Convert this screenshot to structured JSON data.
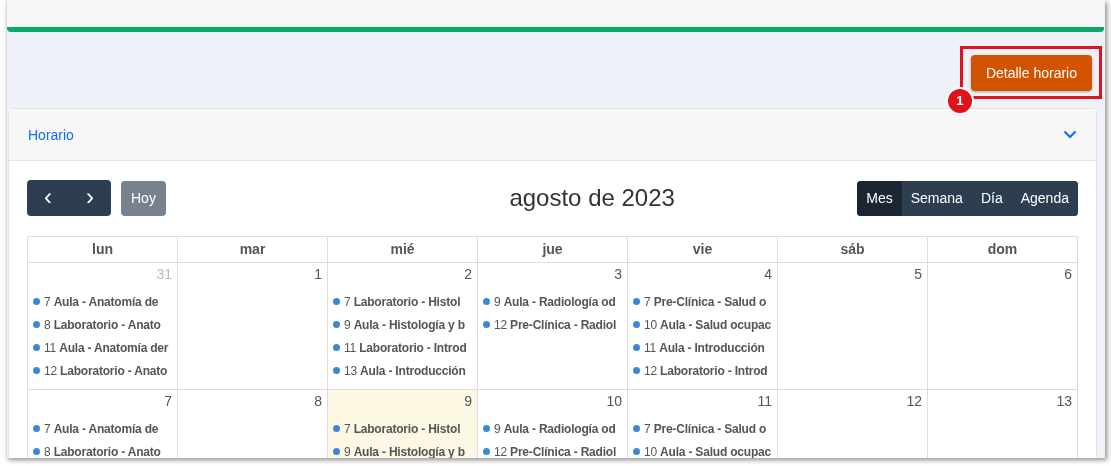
{
  "toolbar": {
    "button": "Detalle horario",
    "callout": "1"
  },
  "panel": {
    "title": "Horario",
    "expanded": true
  },
  "calendar": {
    "prev": "‹",
    "next": "›",
    "today_button": "Hoy",
    "title": "agosto de 2023",
    "views": [
      {
        "label": "Mes",
        "selected": true
      },
      {
        "label": "Semana",
        "selected": false
      },
      {
        "label": "Día",
        "selected": false
      },
      {
        "label": "Agenda",
        "selected": false
      }
    ],
    "weekdays": [
      "lun",
      "mar",
      "mié",
      "jue",
      "vie",
      "sáb",
      "dom"
    ],
    "weeks": [
      {
        "days": [
          {
            "date": "31",
            "off_month": true,
            "today": false,
            "events": [
              {
                "hour": "7",
                "title": "Aula - Anatomía de"
              },
              {
                "hour": "8",
                "title": "Laboratorio - Anato"
              },
              {
                "hour": "11",
                "title": "Aula - Anatomía der"
              },
              {
                "hour": "12",
                "title": "Laboratorio - Anato"
              }
            ]
          },
          {
            "date": "1",
            "off_month": false,
            "today": false
          },
          {
            "date": "2",
            "off_month": false,
            "today": false,
            "events": [
              {
                "hour": "7",
                "title": "Laboratorio - Histol"
              },
              {
                "hour": "9",
                "title": "Aula - Histología y b"
              },
              {
                "hour": "11",
                "title": "Laboratorio - Introd"
              },
              {
                "hour": "13",
                "title": "Aula - Introducción"
              }
            ]
          },
          {
            "date": "3",
            "off_month": false,
            "today": false,
            "events": [
              {
                "hour": "9",
                "title": "Aula - Radiología od"
              },
              {
                "hour": "12",
                "title": "Pre-Clínica - Radiol"
              }
            ]
          },
          {
            "date": "4",
            "off_month": false,
            "today": false,
            "events": [
              {
                "hour": "7",
                "title": "Pre-Clínica - Salud o"
              },
              {
                "hour": "10",
                "title": "Aula - Salud ocupac"
              },
              {
                "hour": "11",
                "title": "Aula - Introducción"
              },
              {
                "hour": "12",
                "title": "Laboratorio - Introd"
              }
            ]
          },
          {
            "date": "5",
            "off_month": false,
            "today": false
          },
          {
            "date": "6",
            "off_month": false,
            "today": false
          }
        ]
      },
      {
        "days": [
          {
            "date": "7",
            "off_month": false,
            "today": false,
            "events": [
              {
                "hour": "7",
                "title": "Aula - Anatomía de"
              },
              {
                "hour": "8",
                "title": "Laboratorio - Anato"
              }
            ]
          },
          {
            "date": "8",
            "off_month": false,
            "today": false
          },
          {
            "date": "9",
            "off_month": false,
            "today": true,
            "events": [
              {
                "hour": "7",
                "title": "Laboratorio - Histol"
              },
              {
                "hour": "9",
                "title": "Aula - Histología y b"
              }
            ]
          },
          {
            "date": "10",
            "off_month": false,
            "today": false,
            "events": [
              {
                "hour": "9",
                "title": "Aula - Radiología od"
              },
              {
                "hour": "12",
                "title": "Pre-Clínica - Radiol"
              }
            ]
          },
          {
            "date": "11",
            "off_month": false,
            "today": false,
            "events": [
              {
                "hour": "7",
                "title": "Pre-Clínica - Salud o"
              },
              {
                "hour": "10",
                "title": "Aula - Salud ocupac"
              }
            ]
          },
          {
            "date": "12",
            "off_month": false,
            "today": false
          },
          {
            "date": "13",
            "off_month": false,
            "today": false
          }
        ]
      }
    ]
  }
}
